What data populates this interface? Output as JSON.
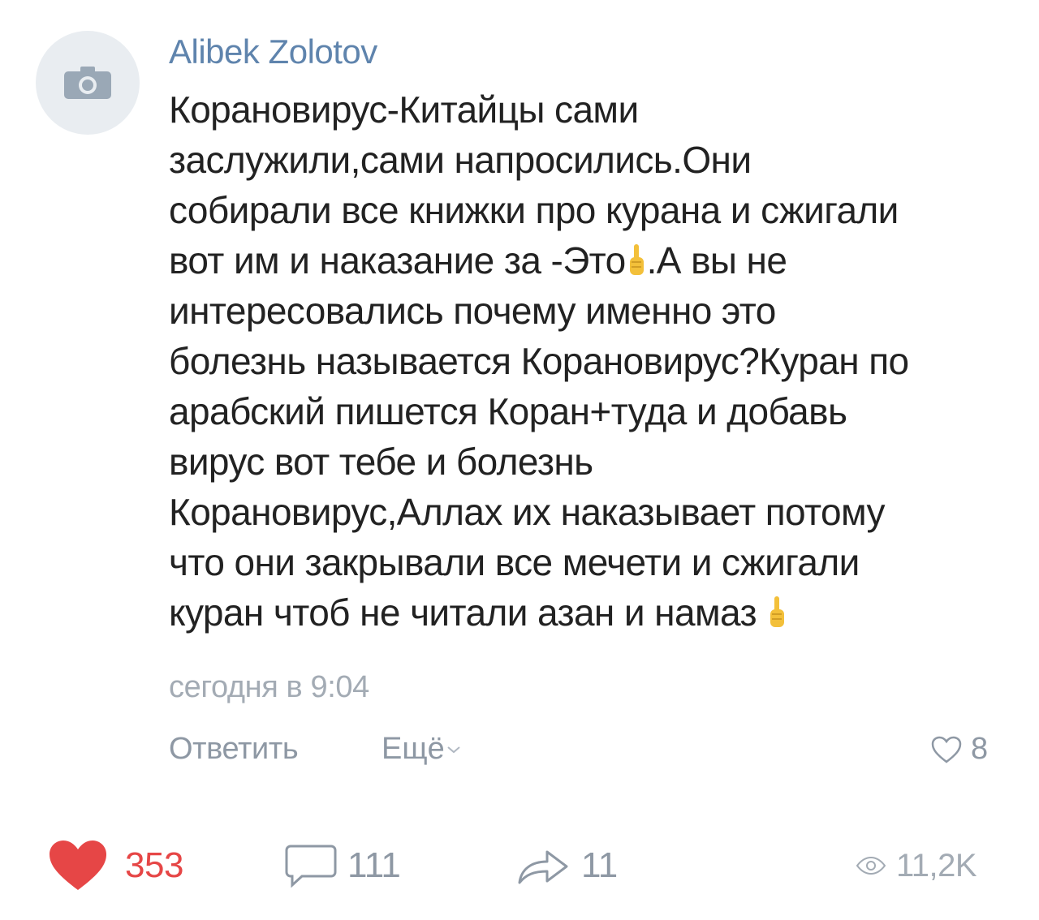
{
  "comment": {
    "author": "Alibek Zolotov",
    "avatar_icon": "camera-icon",
    "text_lines": [
      "Корановирус-Китайцы сами",
      "заслужили,сами напросились.Они",
      "собирали все книжки про курана и сжигали",
      "вот им и наказание за -Это",
      ".А вы не",
      "интересовались почему именно это",
      "болезнь называется Корановирус?Куран по",
      "арабский пишется Коран+туда и добавь",
      "вирус вот тебе и болезнь",
      "Корановирус,Аллах их наказывает потому",
      "что они закрывали все мечети и сжигали",
      "куран чтоб не читали азан и намаз"
    ],
    "timestamp": "сегодня в 9:04",
    "reply_label": "Ответить",
    "more_label": "Ещё",
    "like_count": "8"
  },
  "post_stats": {
    "likes": "353",
    "comments": "111",
    "shares": "11",
    "views": "11,2K"
  },
  "colors": {
    "author": "#5f84ad",
    "text": "#222222",
    "muted": "#8e98a4",
    "like_red": "#e64646",
    "avatar_bg": "#e9edf1"
  }
}
